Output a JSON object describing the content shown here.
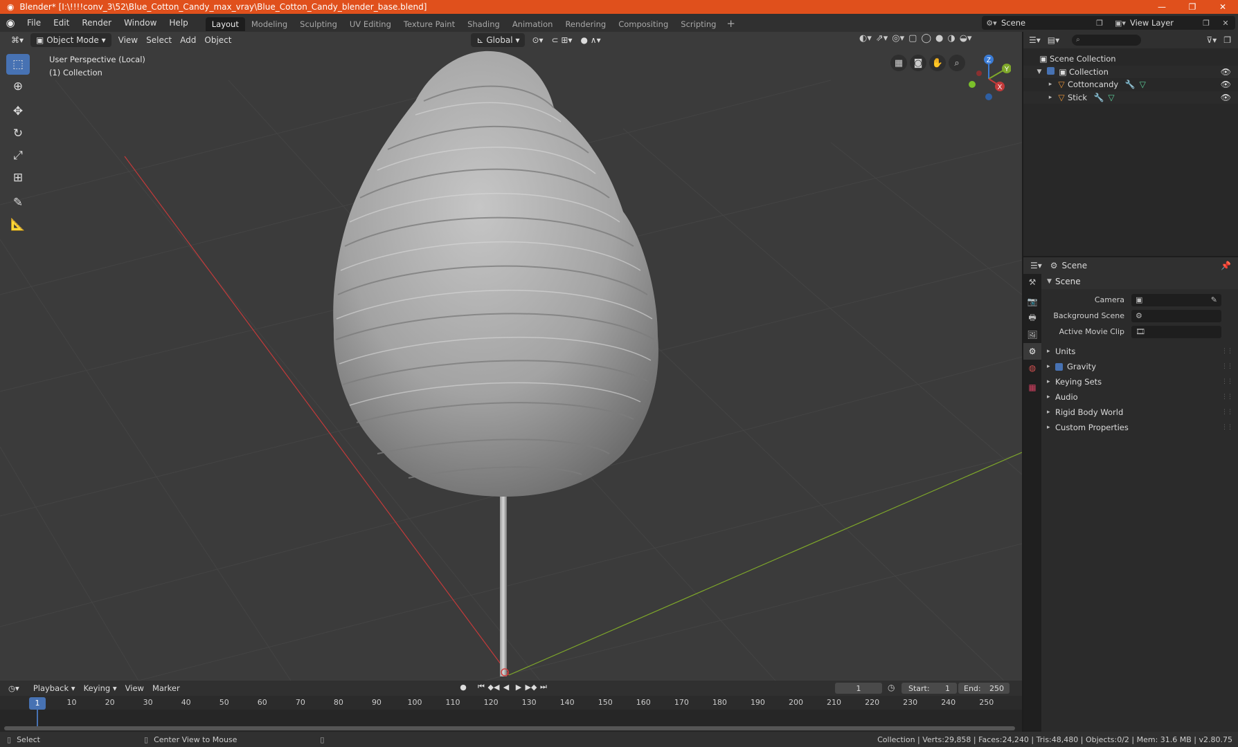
{
  "window": {
    "title": "Blender* [I:\\!!!!conv_3\\52\\Blue_Cotton_Candy_max_vray\\Blue_Cotton_Candy_blender_base.blend]",
    "controls": [
      "—",
      "❐",
      "✕"
    ]
  },
  "menu": [
    "File",
    "Edit",
    "Render",
    "Window",
    "Help"
  ],
  "workspaces": [
    "Layout",
    "Modeling",
    "Sculpting",
    "UV Editing",
    "Texture Paint",
    "Shading",
    "Animation",
    "Rendering",
    "Compositing",
    "Scripting"
  ],
  "active_workspace": "Layout",
  "scene_selector": "Scene",
  "view_layer_selector": "View Layer",
  "viewport": {
    "mode": "Object Mode",
    "menus": [
      "View",
      "Select",
      "Add",
      "Object"
    ],
    "orientation": "Global",
    "info_line1": "User Perspective (Local)",
    "info_line2": "(1) Collection",
    "gizmo_axes": [
      "Z",
      "Y",
      "X"
    ],
    "colors": {
      "x_axis": "#c43a3a",
      "y_axis": "#7fa82a",
      "z_axis": "#3a7bd5",
      "bg": "#3b3b3b"
    }
  },
  "outliner": {
    "root": "Scene Collection",
    "items": [
      {
        "label": "Collection",
        "type": "collection"
      },
      {
        "label": "Cottoncandy",
        "type": "mesh"
      },
      {
        "label": "Stick",
        "type": "mesh"
      }
    ]
  },
  "properties": {
    "context": "Scene",
    "panel": "Scene",
    "rows": [
      {
        "label": "Camera"
      },
      {
        "label": "Background Scene"
      },
      {
        "label": "Active Movie Clip"
      }
    ],
    "subpanels": [
      "Units",
      "Gravity",
      "Keying Sets",
      "Audio",
      "Rigid Body World",
      "Custom Properties"
    ],
    "gravity_checked": true
  },
  "timeline": {
    "menus": [
      "Playback",
      "Keying",
      "View",
      "Marker"
    ],
    "current_frame": "1",
    "start_label": "Start:",
    "start": "1",
    "end_label": "End:",
    "end": "250",
    "ruler": [
      "1",
      "10",
      "20",
      "30",
      "40",
      "50",
      "60",
      "70",
      "80",
      "90",
      "100",
      "110",
      "120",
      "130",
      "140",
      "150",
      "160",
      "170",
      "180",
      "190",
      "200",
      "210",
      "220",
      "230",
      "240",
      "250"
    ]
  },
  "status": {
    "left_action": "Select",
    "mid_action": "Center View to Mouse",
    "stats": "Collection | Verts:29,858 | Faces:24,240 | Tris:48,480 | Objects:0/2 | Mem: 31.6 MB | v2.80.75"
  }
}
